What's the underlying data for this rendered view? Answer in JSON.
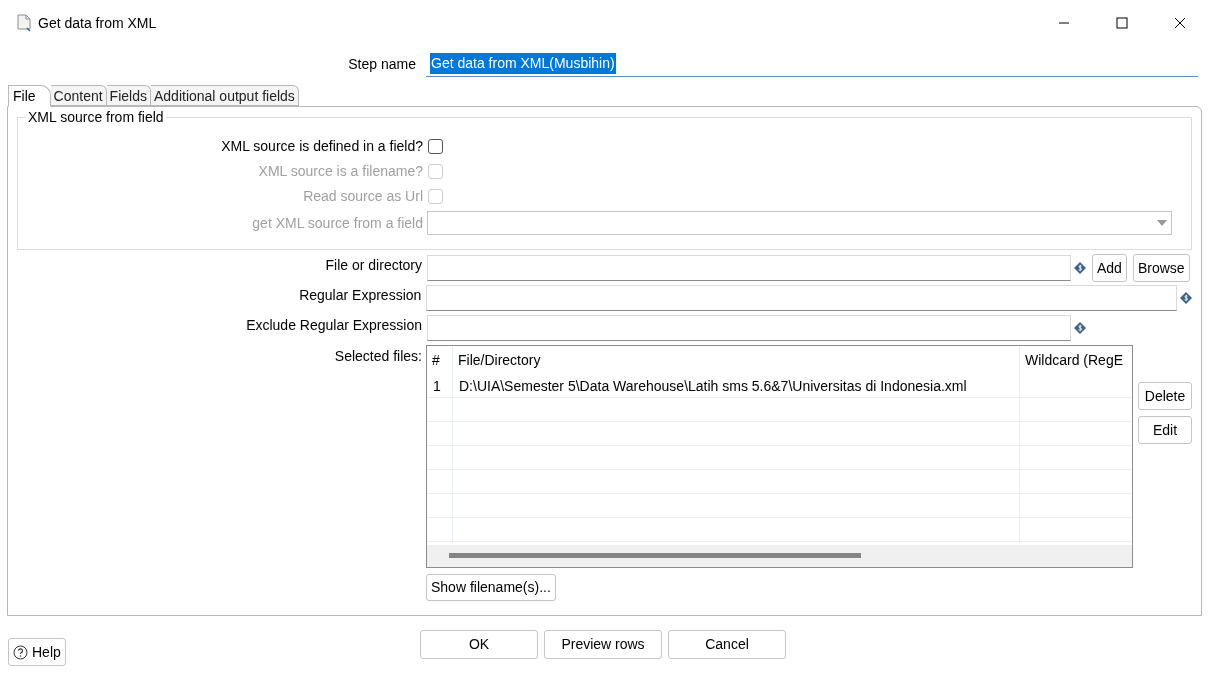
{
  "window": {
    "title": "Get data from XML"
  },
  "step_name": {
    "label": "Step name",
    "value": "Get data from XML(Musbihin)",
    "selected": true
  },
  "tabs": [
    {
      "label": "File",
      "selected": true
    },
    {
      "label": "Content",
      "selected": false
    },
    {
      "label": "Fields",
      "selected": false
    },
    {
      "label": "Additional output fields",
      "selected": false
    }
  ],
  "xml_source_group": {
    "title": "XML source from field",
    "checkboxes": [
      {
        "label": "XML source is defined in a field?",
        "checked": false,
        "disabled": false
      },
      {
        "label": "XML source is a filename?",
        "checked": false,
        "disabled": true
      },
      {
        "label": "Read source as Url",
        "checked": false,
        "disabled": true
      }
    ],
    "source_field": {
      "label": "get XML source from a field",
      "disabled": true
    }
  },
  "file_fields": [
    {
      "label": "File or directory",
      "buttons": [
        "Add",
        "Browse"
      ]
    },
    {
      "label": "Regular Expression"
    },
    {
      "label": "Exclude Regular Expression"
    }
  ],
  "selected_files": {
    "label": "Selected files:",
    "columns": [
      "#",
      "File/Directory",
      "Wildcard (RegE"
    ],
    "rows": [
      [
        "1",
        "D:\\UIA\\Semester 5\\Data Warehouse\\Latih sms 5.6&7\\Universitas di Indonesia.xml",
        ""
      ]
    ],
    "side_buttons": [
      "Delete",
      "Edit"
    ],
    "show_button": "Show filename(s)..."
  },
  "footer": {
    "help": "Help",
    "buttons": [
      "OK",
      "Preview rows",
      "Cancel"
    ]
  }
}
